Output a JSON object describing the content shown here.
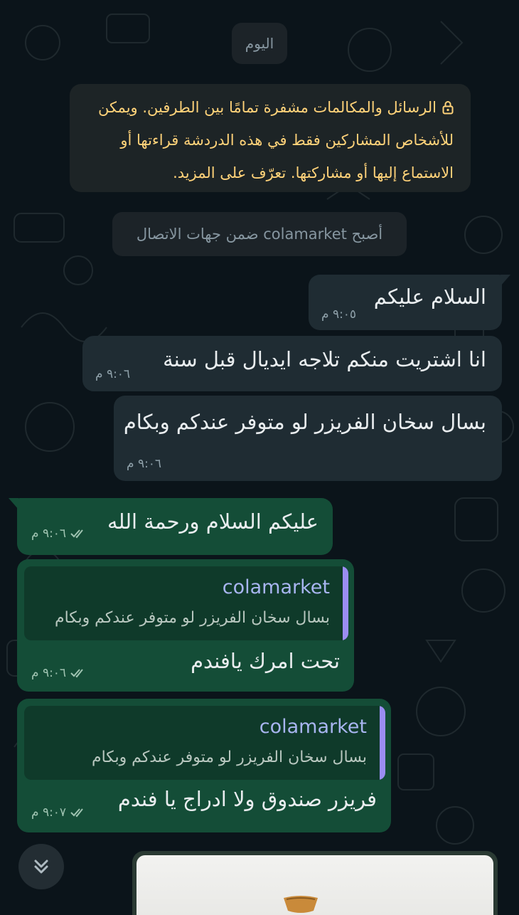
{
  "date_label": "اليوم",
  "encryption_notice": "الرسائل والمكالمات مشفرة تمامًا بين الطرفين. ويمكن للأشخاص المشاركين فقط في هذه الدردشة قراءتها أو الاستماع إليها أو مشاركتها. تعرّف على المزيد.",
  "contact_notice": "أصبح colamarket ضمن جهات الاتصال",
  "messages": [
    {
      "dir": "in",
      "text": "السلام عليكم",
      "time": "٩:٠٥ م"
    },
    {
      "dir": "in",
      "text": "انا اشتريت منكم تلاجه ايديال قبل سنة",
      "time": "٩:٠٦ م"
    },
    {
      "dir": "in",
      "text": "بسال سخان الفريزر لو متوفر عندكم وبكام",
      "time": "٩:٠٦ م"
    },
    {
      "dir": "out",
      "text": "عليكم السلام ورحمة الله",
      "time": "٩:٠٦ م"
    },
    {
      "dir": "out",
      "quote_author": "colamarket",
      "quote_text": "بسال سخان الفريزر لو متوفر عندكم وبكام",
      "text": "تحت امرك يافندم",
      "time": "٩:٠٦ م"
    },
    {
      "dir": "out",
      "quote_author": "colamarket",
      "quote_text": "بسال سخان الفريزر لو متوفر عندكم وبكام",
      "text": "فريزر صندوق ولا ادراج يا فندم",
      "time": "٩:٠٧ م"
    }
  ],
  "icons": {
    "lock": "lock-icon",
    "read_ticks": "double-check-icon",
    "scroll_down": "chevrons-down-icon"
  },
  "colors": {
    "background": "#0b141a",
    "incoming_bubble": "#1f2c33",
    "outgoing_bubble": "#144d37",
    "notice_text": "#ffd279",
    "read_ticks": "#9fc3b1",
    "quote_bar": "#9b8df2"
  }
}
